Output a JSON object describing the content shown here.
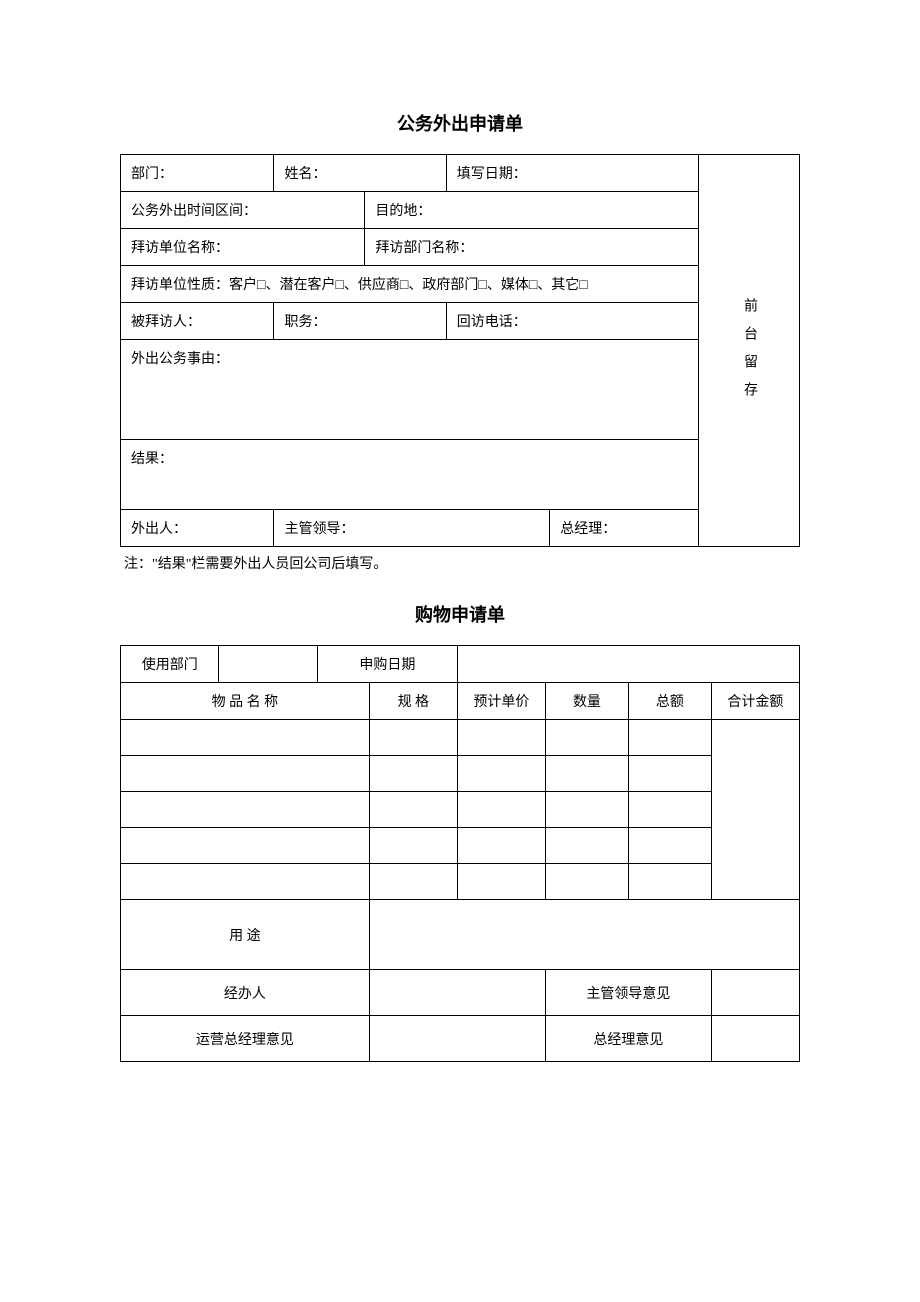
{
  "form1": {
    "title": "公务外出申请单",
    "row1": {
      "dept": "部门：",
      "name": "姓名：",
      "fillDate": "填写日期："
    },
    "row2": {
      "timeRange": "公务外出时间区间：",
      "destination": "目的地："
    },
    "row3": {
      "visitOrgName": "拜访单位名称：",
      "visitDeptName": "拜访部门名称："
    },
    "row4": {
      "visitOrgType": "拜访单位性质：客户□、潜在客户□、供应商□、政府部门□、媒体□、其它□"
    },
    "row5": {
      "visitee": "被拜访人：",
      "position": "职务：",
      "callback": "回访电话："
    },
    "row6": {
      "reason": "外出公务事由："
    },
    "row7": {
      "result": "结果："
    },
    "row8": {
      "outPerson": "外出人：",
      "supervisor": "主管领导：",
      "gm": "总经理："
    },
    "sideNote": "前台留存",
    "note": "注：\"结果\"栏需要外出人员回公司后填写。"
  },
  "form2": {
    "title": "购物申请单",
    "headerRow": {
      "useDept": "使用部门",
      "purchaseDate": "申购日期"
    },
    "columns": {
      "itemName": "物 品 名 称",
      "spec": "规 格",
      "estPrice": "预计单价",
      "qty": "数量",
      "total": "总额",
      "grandTotal": "合计金额"
    },
    "labels": {
      "purpose": "用 途",
      "handler": "经办人",
      "supervisorOpinion": "主管领导意见",
      "opsGmOpinion": "运营总经理意见",
      "gmOpinion": "总经理意见"
    }
  }
}
